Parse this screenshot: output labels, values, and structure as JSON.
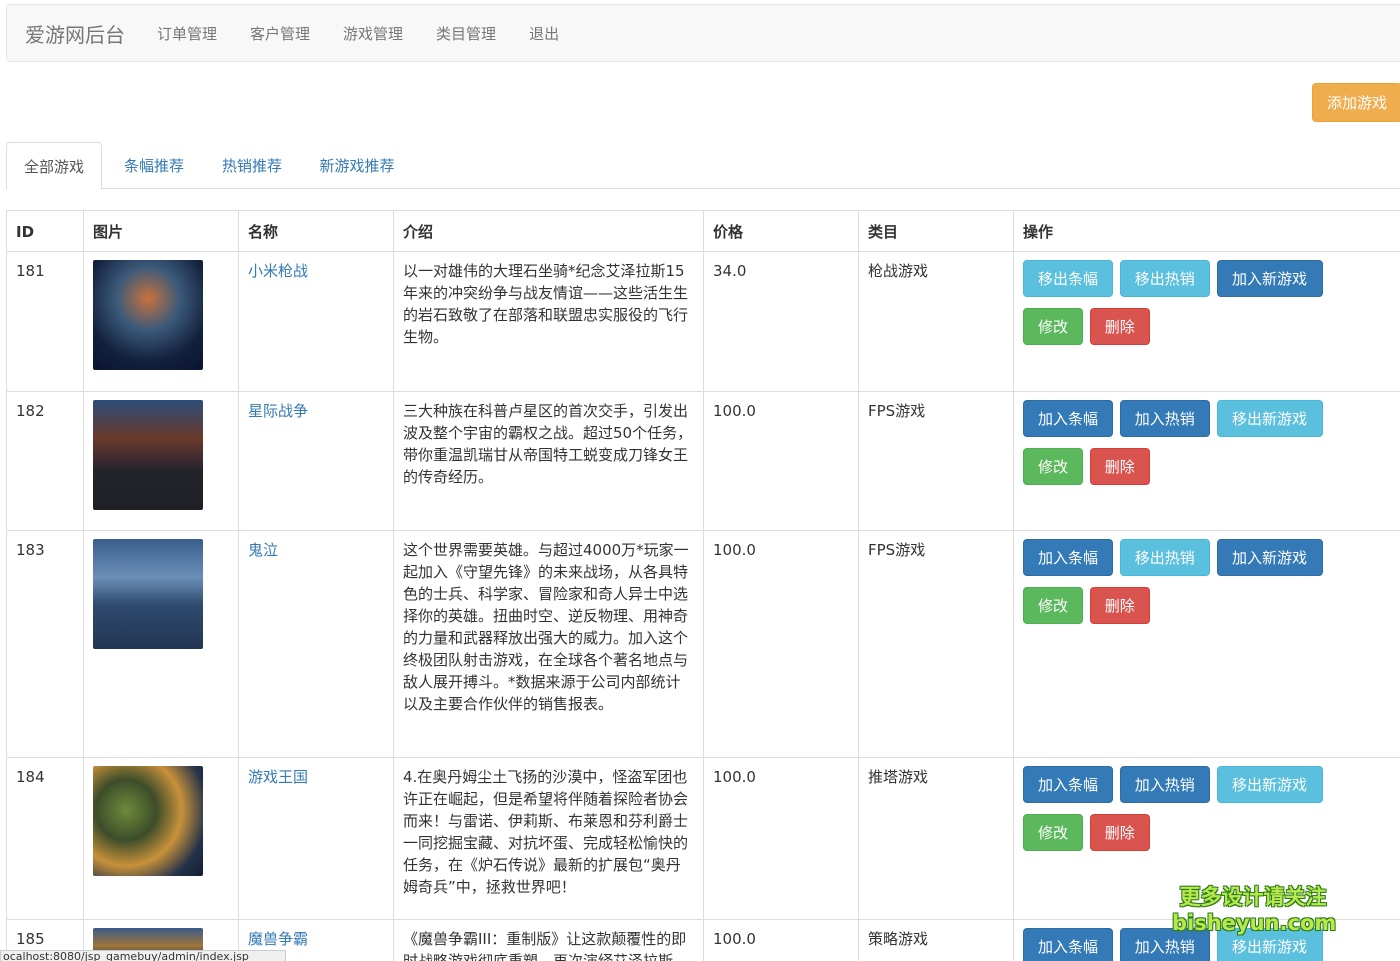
{
  "navbar": {
    "brand": "爱游网后台",
    "links": [
      "订单管理",
      "客户管理",
      "游戏管理",
      "类目管理",
      "退出"
    ]
  },
  "add_button": "添加游戏",
  "tabs": [
    "全部游戏",
    "条幅推荐",
    "热销推荐",
    "新游戏推荐"
  ],
  "table": {
    "headers": [
      "ID",
      "图片",
      "名称",
      "介绍",
      "价格",
      "类目",
      "操作"
    ],
    "edit_label": "修改",
    "delete_label": "删除",
    "rows": [
      {
        "id": "181",
        "name": "小米枪战",
        "desc": "以一对雄伟的大理石坐骑*纪念艾泽拉斯15年来的冲突纷争与战友情谊——这些活生生的岩石致敬了在部落和联盟忠实服役的飞行生物。",
        "price": "34.0",
        "category": "枪战游戏",
        "banner_btn": "移出条幅",
        "hot_btn": "移出热销",
        "new_btn": "加入新游戏"
      },
      {
        "id": "182",
        "name": "星际战争",
        "desc": "三大种族在科普卢星区的首次交手，引发出波及整个宇宙的霸权之战。超过50个任务，带你重温凯瑞甘从帝国特工蜕变成刀锋女王的传奇经历。",
        "price": "100.0",
        "category": "FPS游戏",
        "banner_btn": "加入条幅",
        "hot_btn": "加入热销",
        "new_btn": "移出新游戏"
      },
      {
        "id": "183",
        "name": "鬼泣",
        "desc": "这个世界需要英雄。与超过4000万*玩家一起加入《守望先锋》的未来战场，从各具特色的士兵、科学家、冒险家和奇人异士中选择你的英雄。扭曲时空、逆反物理、用神奇的力量和武器释放出强大的威力。加入这个终极团队射击游戏，在全球各个著名地点与敌人展开搏斗。*数据来源于公司内部统计以及主要合作伙伴的销售报表。",
        "price": "100.0",
        "category": "FPS游戏",
        "banner_btn": "加入条幅",
        "hot_btn": "移出热销",
        "new_btn": "加入新游戏"
      },
      {
        "id": "184",
        "name": "游戏王国",
        "desc": "4.在奥丹姆尘土飞扬的沙漠中，怪盗军团也许正在崛起，但是希望将伴随着探险者协会而来！与雷诺、伊莉斯、布莱恩和芬利爵士一同挖掘宝藏、对抗坏蛋、完成轻松愉快的任务，在《炉石传说》最新的扩展包“奥丹姆奇兵”中，拯救世界吧！",
        "price": "100.0",
        "category": "推塔游戏",
        "banner_btn": "加入条幅",
        "hot_btn": "加入热销",
        "new_btn": "移出新游戏"
      },
      {
        "id": "185",
        "name": "魔兽争霸",
        "desc": "《魔兽争霸III：重制版》让这款颠覆性的即时战略游戏彻底重塑，再次演绎艾泽拉斯",
        "price": "100.0",
        "category": "策略游戏",
        "banner_btn": "加入条幅",
        "hot_btn": "加入热销",
        "new_btn": "移出新游戏"
      }
    ]
  },
  "statusbar": "ocalhost:8080/jsp_gamebuy/admin/index.jsp",
  "watermark": [
    "更多设计请关注",
    "bisheyun.com"
  ],
  "colors": {
    "warning": "#f0ad4e",
    "info": "#5bc0de",
    "primary": "#337ab7",
    "success": "#5cb85c",
    "danger": "#d9534f"
  }
}
